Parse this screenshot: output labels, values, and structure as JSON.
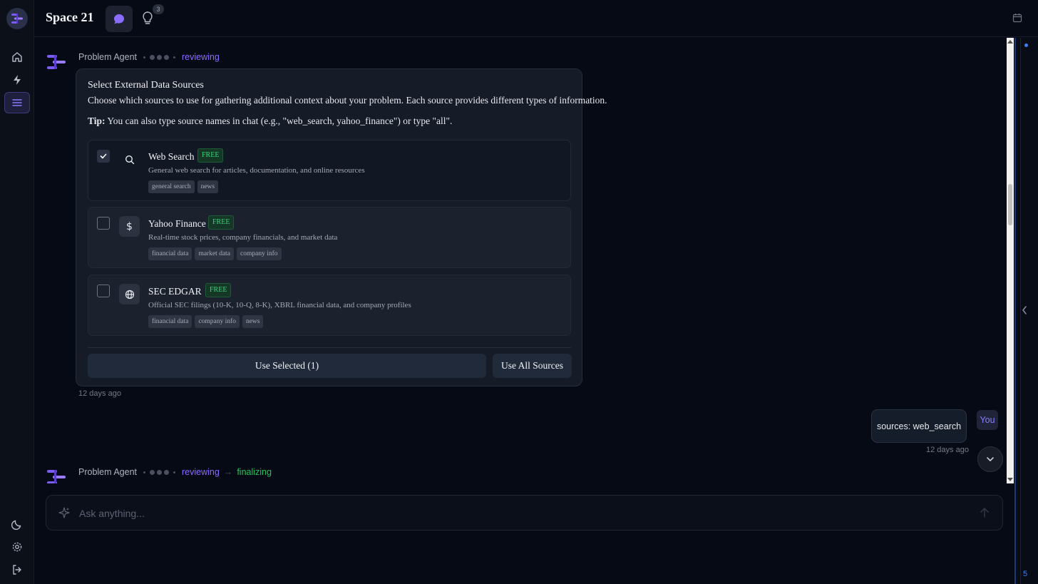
{
  "app": {
    "title": "Space 21",
    "insights_count": "3"
  },
  "rail": {
    "items": [
      {
        "icon": "home-icon"
      },
      {
        "icon": "bolt-icon"
      },
      {
        "icon": "list-icon",
        "active": true
      }
    ],
    "bottom": [
      {
        "icon": "moon-icon"
      },
      {
        "icon": "gear-icon"
      },
      {
        "icon": "logout-icon"
      }
    ]
  },
  "messages": {
    "first": {
      "agent": "Problem Agent",
      "status": "reviewing",
      "card": {
        "title": "Select External Data Sources",
        "description": "Choose which sources to use for gathering additional context about your problem. Each source provides different types of information.",
        "tip_label": "Tip:",
        "tip_text": " You can also type source names in chat (e.g., \"web_search, yahoo_finance\") or type \"all\".",
        "sources": [
          {
            "name": "Web Search",
            "badge": "FREE",
            "description": "General web search for articles, documentation, and online resources",
            "tags": [
              "general search",
              "news"
            ],
            "checked": true,
            "icon": "search-icon"
          },
          {
            "name": "Yahoo Finance",
            "badge": "FREE",
            "description": "Real-time stock prices, company financials, and market data",
            "tags": [
              "financial data",
              "market data",
              "company info"
            ],
            "checked": false,
            "icon": "dollar-icon"
          },
          {
            "name": "SEC EDGAR",
            "badge": "FREE",
            "description": "Official SEC filings (10-K, 10-Q, 8-K), XBRL financial data, and company profiles",
            "tags": [
              "financial data",
              "company info",
              "news"
            ],
            "checked": false,
            "icon": "globe-icon"
          }
        ],
        "use_selected_label": "Use Selected (1)",
        "use_all_label": "Use All Sources"
      },
      "timestamp": "12 days ago"
    },
    "user": {
      "text": "sources: web_search",
      "author": "You",
      "timestamp": "12 days ago"
    },
    "second": {
      "agent": "Problem Agent",
      "status": "reviewing",
      "arrow": "→",
      "next_status": "finalizing"
    }
  },
  "composer": {
    "placeholder": "Ask anything..."
  },
  "right_panel": {
    "count": "5"
  },
  "colors": {
    "accent": "#8b6cff",
    "success": "#22c55e",
    "panel_border": "#1d3a78"
  }
}
